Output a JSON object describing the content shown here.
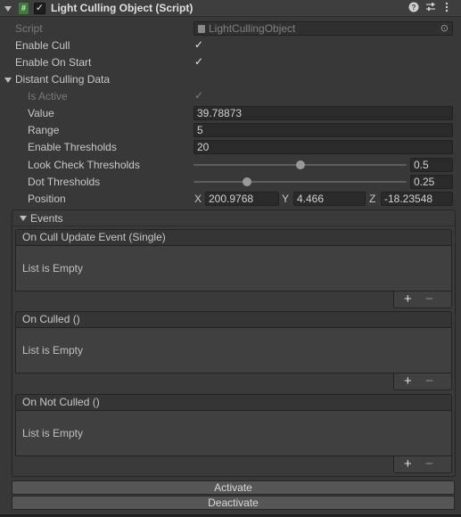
{
  "header": {
    "title": "Light Culling Object (Script)",
    "script_icon_text": "#",
    "enabled": true,
    "icons": [
      "help-icon",
      "presets-icon",
      "kebab-menu-icon"
    ]
  },
  "fields": {
    "script": {
      "label": "Script",
      "value": "LightCullingObject"
    },
    "enable_cull": {
      "label": "Enable Cull",
      "checked": true
    },
    "enable_on_start": {
      "label": "Enable On Start",
      "checked": true
    },
    "distant_culling_data": {
      "label": "Distant Culling Data",
      "expanded": true
    },
    "is_active": {
      "label": "Is Active",
      "checked": true,
      "disabled": true
    },
    "value": {
      "label": "Value",
      "value": "39.78873"
    },
    "range": {
      "label": "Range",
      "value": "5"
    },
    "enable_thresholds": {
      "label": "Enable Thresholds",
      "value": "20"
    },
    "look_check_thresholds": {
      "label": "Look Check Thresholds",
      "value": "0.5",
      "fraction": 0.5
    },
    "dot_thresholds": {
      "label": "Dot Thresholds",
      "value": "0.25",
      "fraction": 0.25
    },
    "position": {
      "label": "Position",
      "x_label": "X",
      "x": "200.9768",
      "y_label": "Y",
      "y": "4.466",
      "z_label": "Z",
      "z": "-18.23548"
    }
  },
  "events": {
    "label": "Events",
    "items": [
      {
        "title": "On Cull Update Event (Single)",
        "empty_text": "List is Empty"
      },
      {
        "title": "On Culled ()",
        "empty_text": "List is Empty"
      },
      {
        "title": "On Not Culled ()",
        "empty_text": "List is Empty"
      }
    ],
    "add_symbol": "+",
    "remove_symbol": "−"
  },
  "buttons": {
    "activate": "Activate",
    "deactivate": "Deactivate"
  },
  "glyphs": {
    "check": "✓",
    "target": "⊙"
  }
}
